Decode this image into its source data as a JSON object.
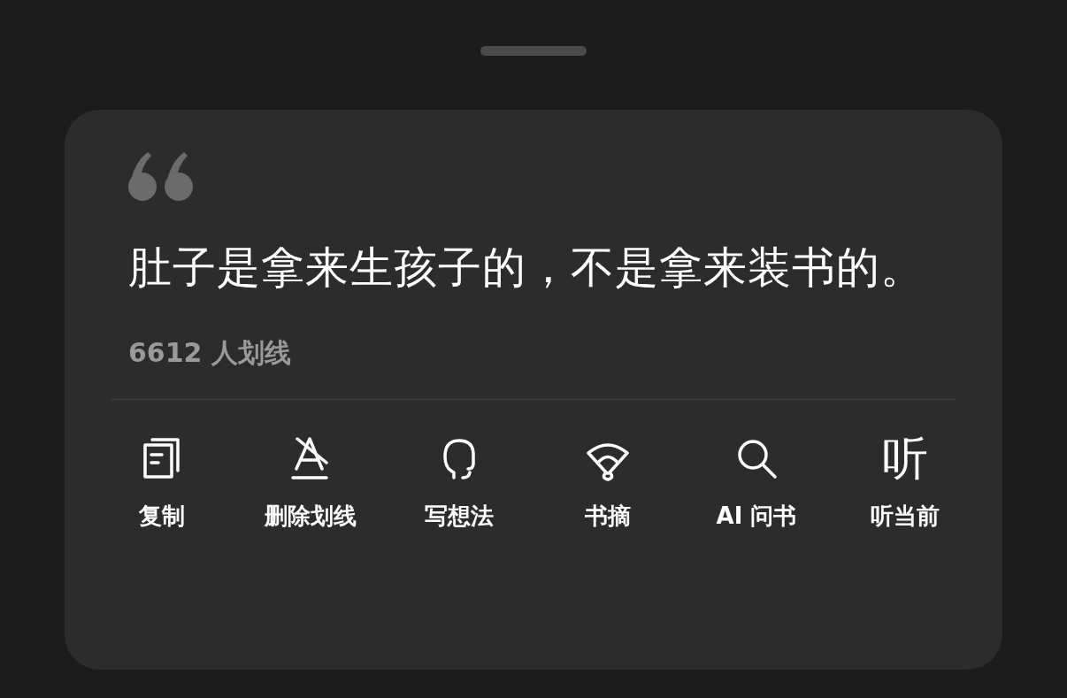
{
  "quote": {
    "text": "肚子是拿来生孩子的，不是拿来装书的。",
    "count": "6612 人划线"
  },
  "actions": [
    {
      "kind": "copy",
      "label": "复制"
    },
    {
      "kind": "strike",
      "label": "删除划线"
    },
    {
      "kind": "head",
      "label": "写想法"
    },
    {
      "kind": "fan",
      "label": "书摘"
    },
    {
      "kind": "search",
      "label": "AI 问书"
    },
    {
      "kind": "glyph",
      "glyph": "听",
      "label": "听当前"
    }
  ]
}
